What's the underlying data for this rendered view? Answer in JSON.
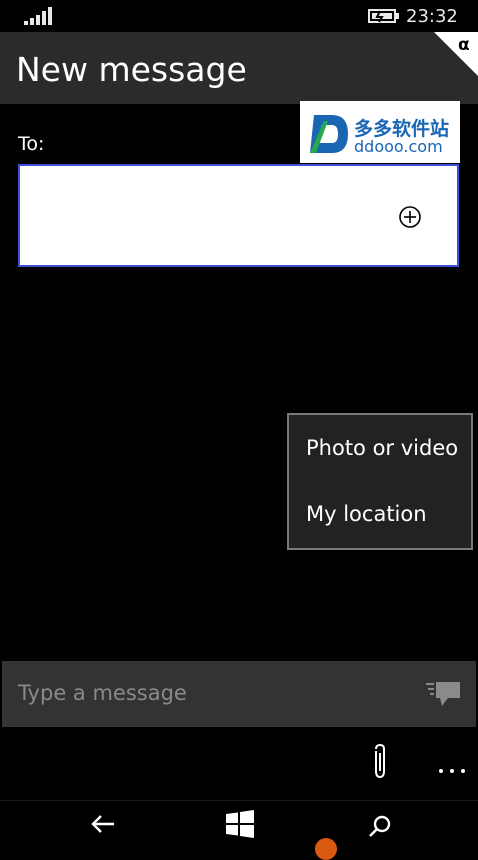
{
  "status_bar": {
    "time": "23:32",
    "icons": [
      "signal-bars-icon",
      "battery-charging-icon"
    ]
  },
  "header": {
    "title": "New message",
    "corner_badge": "α"
  },
  "watermark": {
    "brand_cn": "多多软件站",
    "brand_url": "ddooo.com"
  },
  "recipient": {
    "label": "To:",
    "value": "",
    "add_icon": "plus-circle-icon"
  },
  "attach_menu": {
    "items": [
      {
        "label": "Photo or video"
      },
      {
        "label": "My location"
      }
    ]
  },
  "compose": {
    "placeholder": "Type a message",
    "send_icon": "send-message-icon"
  },
  "app_bar": {
    "icons": [
      "paperclip-icon",
      "more-icon"
    ]
  },
  "nav_bar": {
    "icons": [
      "back-arrow-icon",
      "windows-logo-icon",
      "search-icon"
    ]
  },
  "colors": {
    "accent_border": "#3f51d8",
    "title_bar": "#2b2b2b",
    "compose_bar": "#333333",
    "brand_blue": "#1a66b3",
    "indicator_orange": "#d85a10"
  }
}
